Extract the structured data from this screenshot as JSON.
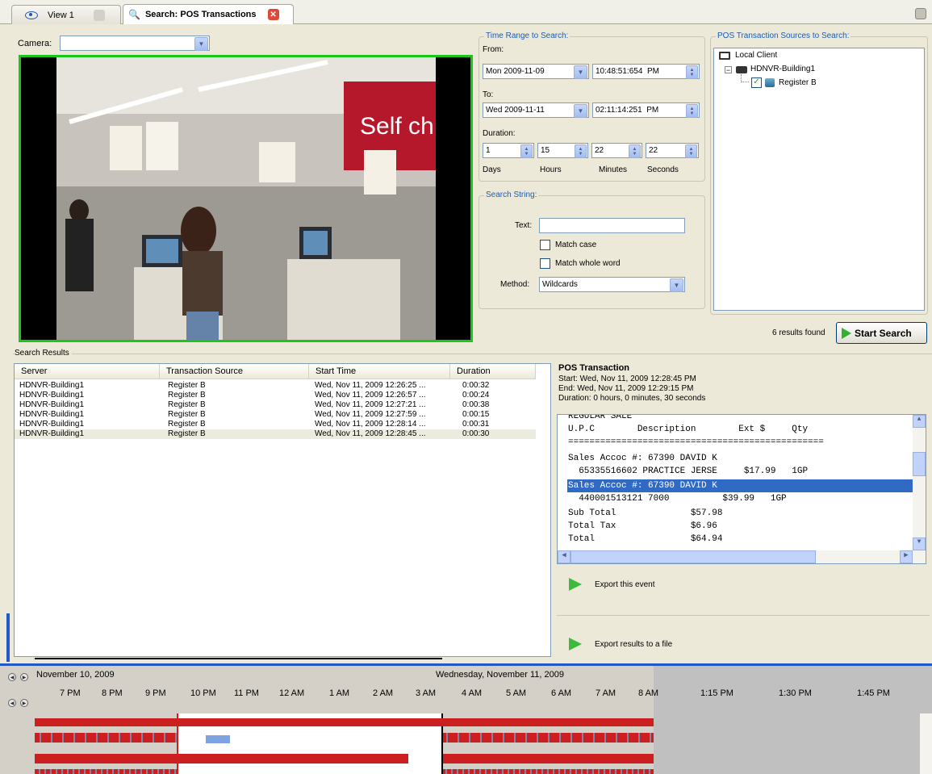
{
  "tabs": [
    {
      "label": "View 1",
      "active": false
    },
    {
      "label": "Search: POS Transactions",
      "active": true
    }
  ],
  "camera": {
    "label": "Camera:",
    "value": ""
  },
  "time_range": {
    "legend": "Time Range to Search:",
    "from_label": "From:",
    "from_date": "Mon 2009-11-09",
    "from_time": "10:48:51:654  PM",
    "to_label": "To:",
    "to_date": "Wed 2009-11-11",
    "to_time": "02:11:14:251  PM",
    "duration_label": "Duration:",
    "days": "1",
    "hours": "15",
    "minutes": "22",
    "seconds": "22",
    "days_label": "Days",
    "hours_label": "Hours",
    "minutes_label": "Minutes",
    "seconds_label": "Seconds"
  },
  "sources": {
    "legend": "POS Transaction Sources to Search:",
    "local_client": "Local Client",
    "server": "HDNVR-Building1",
    "register": "Register B"
  },
  "search_string": {
    "legend": "Search String:",
    "text_label": "Text:",
    "text_value": "",
    "match_case": "Match case",
    "match_whole": "Match whole word",
    "method_label": "Method:",
    "method_value": "Wildcards"
  },
  "results_found": "6 results found",
  "start_search": "Start Search",
  "search_results": {
    "label": "Search Results",
    "columns": [
      "Server",
      "Transaction Source",
      "Start Time",
      "Duration"
    ],
    "rows": [
      [
        "HDNVR-Building1",
        "Register B",
        "Wed, Nov 11, 2009 12:26:25 ...",
        "0:00:32"
      ],
      [
        "HDNVR-Building1",
        "Register B",
        "Wed, Nov 11, 2009 12:26:57 ...",
        "0:00:24"
      ],
      [
        "HDNVR-Building1",
        "Register B",
        "Wed, Nov 11, 2009 12:27:21 ...",
        "0:00:38"
      ],
      [
        "HDNVR-Building1",
        "Register B",
        "Wed, Nov 11, 2009 12:27:59 ...",
        "0:00:15"
      ],
      [
        "HDNVR-Building1",
        "Register B",
        "Wed, Nov 11, 2009 12:28:14 ...",
        "0:00:31"
      ],
      [
        "HDNVR-Building1",
        "Register B",
        "Wed, Nov 11, 2009 12:28:45 ...",
        "0:00:30"
      ]
    ]
  },
  "pos_transaction": {
    "title": "POS Transaction",
    "start": "Start: Wed, Nov 11, 2009 12:28:45 PM",
    "end": "End: Wed, Nov 11, 2009 12:29:15 PM",
    "duration": "Duration: 0 hours, 0 minutes, 30 seconds",
    "receipt_lines": [
      "REGULAR SALE",
      "U.P.C        Description        Ext $     Qty",
      "================================================",
      "Sales Accoc #: 67390 DAVID K",
      "  65335516602 PRACTICE JERSE     $17.99   1GP",
      "Sales Accoc #: 67390 DAVID K",
      "  440001513121 7000          $39.99   1GP",
      "Sub Total              $57.98",
      "Total Tax              $6.96",
      "Total                  $64.94"
    ],
    "export_event": "Export this event",
    "export_file": "Export results to a file"
  },
  "timeline": {
    "date_left": "November 10, 2009",
    "date_right": "Wednesday, November 11, 2009",
    "hours": [
      "7 PM",
      "8 PM",
      "9 PM",
      "10 PM",
      "11 PM",
      "12 AM",
      "1 AM",
      "2 AM",
      "3 AM",
      "4 AM",
      "5 AM",
      "6 AM",
      "7 AM",
      "8 AM",
      "1:15 PM",
      "1:30 PM",
      "1:45 PM"
    ]
  },
  "colors": {
    "accent_blue": "#316ac5",
    "video_border": "#19c619",
    "track_red": "#cc1f1f",
    "legend_blue": "#1c5cb4"
  }
}
